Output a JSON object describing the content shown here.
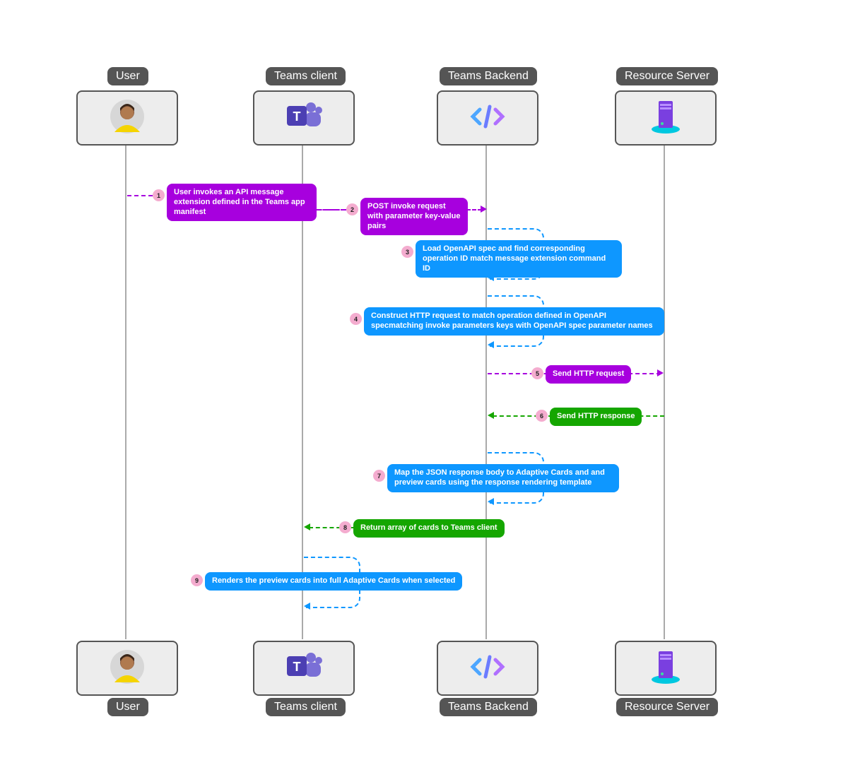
{
  "participants": {
    "user": {
      "label": "User"
    },
    "client": {
      "label": "Teams client"
    },
    "backend": {
      "label": "Teams Backend"
    },
    "server": {
      "label": "Resource Server"
    }
  },
  "steps": [
    {
      "n": "1",
      "text": "User invokes an API message extension defined in the Teams app manifest"
    },
    {
      "n": "2",
      "text": "POST invoke request with parameter key-value pairs"
    },
    {
      "n": "3",
      "text": "Load OpenAPI spec and find corresponding operation ID match message extension command ID"
    },
    {
      "n": "4",
      "text": "Construct HTTP request to match operation defined in OpenAPI specmatching invoke parameters keys with OpenAPI spec parameter names"
    },
    {
      "n": "5",
      "text": "Send HTTP request"
    },
    {
      "n": "6",
      "text": "Send HTTP response"
    },
    {
      "n": "7",
      "text": "Map the JSON response body to  Adaptive Cards and  and preview cards using the response rendering template"
    },
    {
      "n": "8",
      "text": "Return array of cards to Teams client"
    },
    {
      "n": "9",
      "text": "Renders the preview cards into full Adaptive Cards when selected"
    }
  ],
  "colors": {
    "purple": "#A700DE",
    "blue": "#0E97FF",
    "green": "#15A600",
    "pink": "#F4ACCF",
    "grey": "#555555"
  },
  "lanes_x": {
    "user": 178,
    "client": 428,
    "backend": 688,
    "server": 940
  }
}
